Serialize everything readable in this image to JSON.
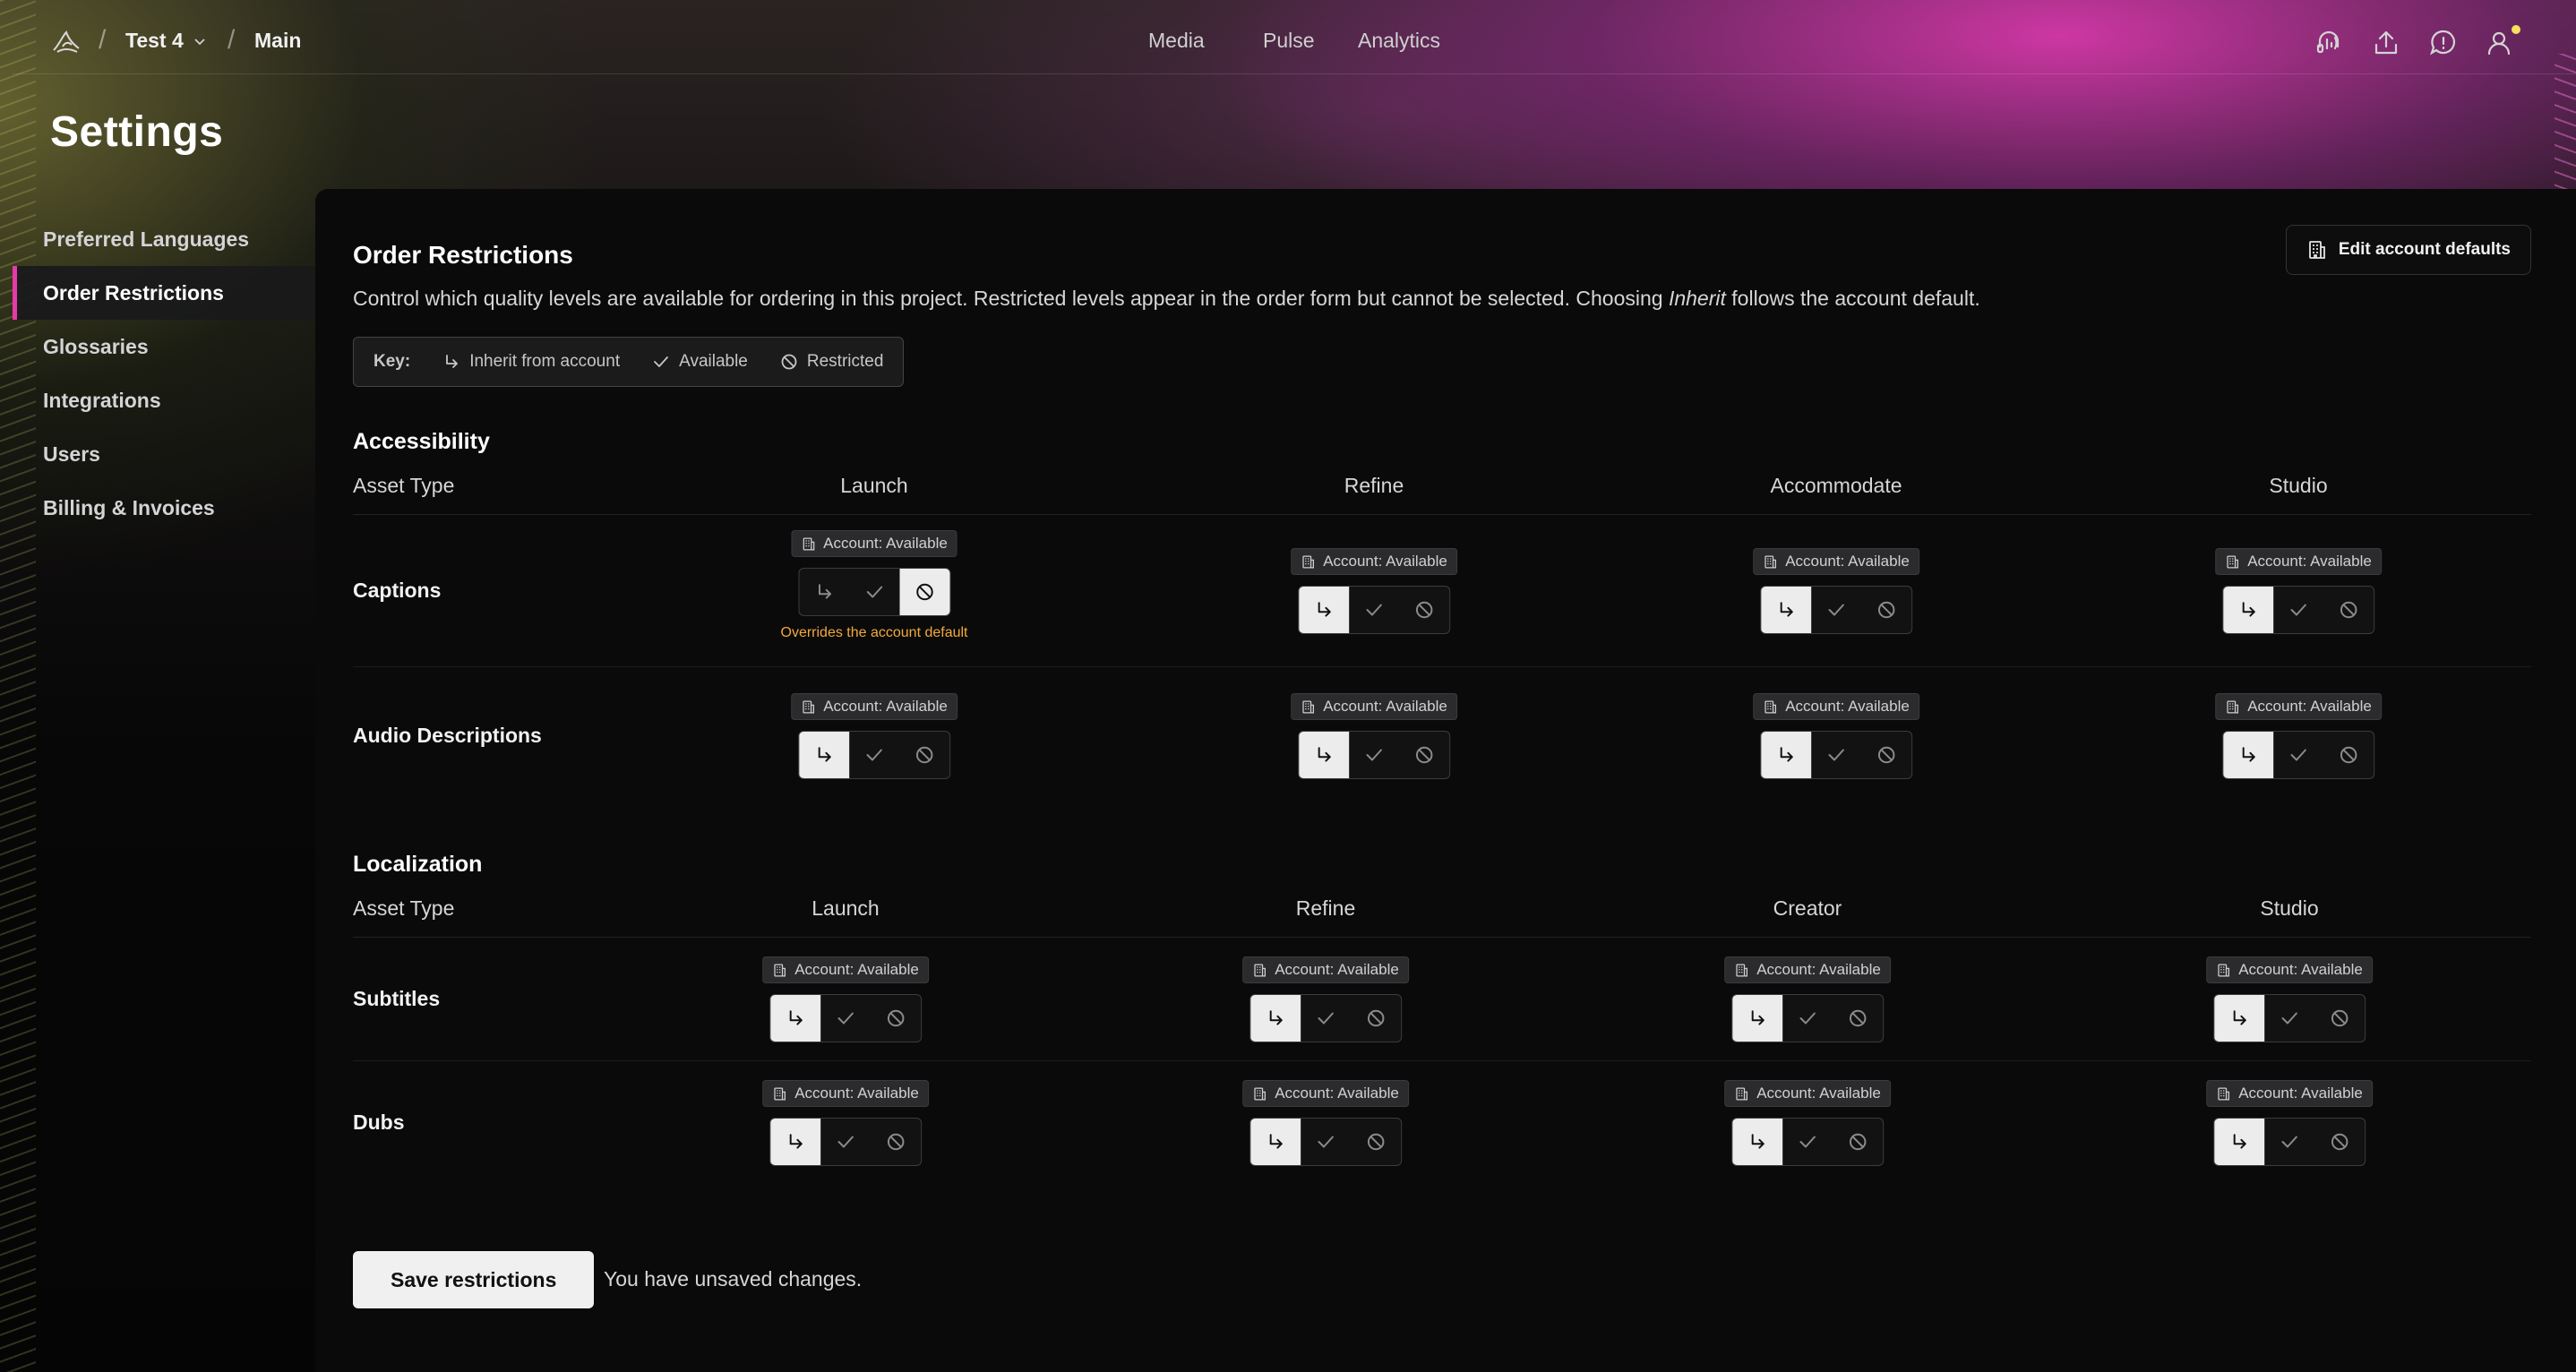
{
  "topbar": {
    "breadcrumb_project": "Test 4",
    "breadcrumb_branch": "Main",
    "nav": [
      "Media",
      "Pulse",
      "Analytics"
    ]
  },
  "page": {
    "title": "Settings"
  },
  "sidebar": {
    "items": [
      "Preferred Languages",
      "Order Restrictions",
      "Glossaries",
      "Integrations",
      "Users",
      "Billing & Invoices"
    ],
    "active_index": 1
  },
  "main": {
    "title": "Order Restrictions",
    "description_pre": "Control which quality levels are available for ordering in this project. Restricted levels appear in the order form but cannot be selected. Choosing ",
    "description_em": "Inherit",
    "description_post": " follows the account default.",
    "edit_button": "Edit account defaults",
    "key": {
      "label": "Key:",
      "inherit": "Inherit from account",
      "available": "Available",
      "restricted": "Restricted"
    },
    "asset_type_header": "Asset Type",
    "account_badge": "Account: Available",
    "override_note": "Overrides the account default",
    "sections": [
      {
        "title": "Accessibility",
        "columns": [
          "Launch",
          "Refine",
          "Accommodate",
          "Studio"
        ],
        "rows": [
          {
            "label": "Captions",
            "states": [
              "restricted",
              "inherit",
              "inherit",
              "inherit"
            ]
          },
          {
            "label": "Audio Descriptions",
            "states": [
              "inherit",
              "inherit",
              "inherit",
              "inherit"
            ]
          }
        ]
      },
      {
        "title": "Localization",
        "columns": [
          "Launch",
          "Refine",
          "Creator",
          "Studio"
        ],
        "rows": [
          {
            "label": "Subtitles",
            "states": [
              "inherit",
              "inherit",
              "inherit",
              "inherit"
            ]
          },
          {
            "label": "Dubs",
            "states": [
              "inherit",
              "inherit",
              "inherit",
              "inherit"
            ]
          }
        ]
      }
    ],
    "save_button": "Save restrictions",
    "unsaved_text": "You have unsaved changes."
  },
  "colors": {
    "accent": "#e63aa6",
    "warning": "#f2a93b"
  },
  "icons": [
    "logo-icon",
    "chevron-down-icon",
    "headset-icon",
    "upload-icon",
    "chat-icon",
    "user-icon",
    "building-icon",
    "inherit-arrow-icon",
    "check-icon",
    "restricted-icon"
  ]
}
